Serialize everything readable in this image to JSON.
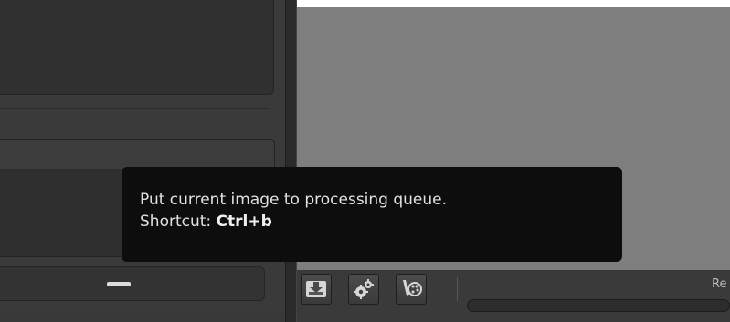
{
  "tooltip": {
    "line1": "Put current image to processing queue.",
    "shortcut_prefix": "Shortcut: ",
    "shortcut_keys": "Ctrl+b"
  },
  "toolbar": {
    "label_partial": "Re",
    "buttons": [
      {
        "icon": "queue-download-icon"
      },
      {
        "icon": "gears-icon"
      },
      {
        "icon": "palette-brush-icon"
      }
    ]
  },
  "collapse": {
    "icon": "minus-icon"
  },
  "colors": {
    "tooltip_bg": "#0d0d0d",
    "preview_bg": "#7e7e7e",
    "panel_bg": "#3a3a3a"
  }
}
